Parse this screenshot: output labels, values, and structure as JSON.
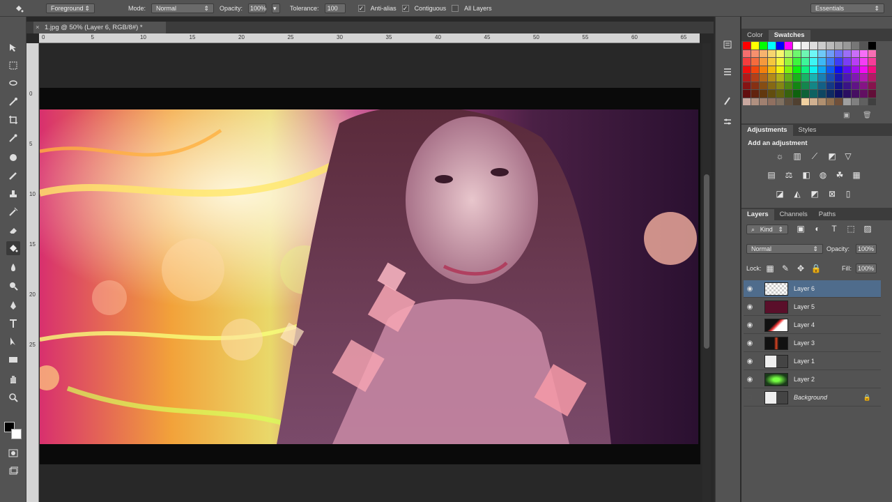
{
  "options_bar": {
    "brush_preset": "Foreground",
    "mode_label": "Mode:",
    "mode_value": "Normal",
    "opacity_label": "Opacity:",
    "opacity_value": "100%",
    "tolerance_label": "Tolerance:",
    "tolerance_value": "100",
    "anti_alias": "Anti-alias",
    "contiguous": "Contiguous",
    "all_layers": "All Layers",
    "workspace": "Essentials"
  },
  "document": {
    "tab_title": "1.jpg @ 50% (Layer 6, RGB/8#) *",
    "ruler_h": [
      "0",
      "5",
      "10",
      "15",
      "20",
      "25",
      "30",
      "35",
      "40",
      "45",
      "50",
      "55",
      "60",
      "65"
    ],
    "ruler_v": [
      "0",
      "5",
      "10",
      "15",
      "20",
      "25"
    ]
  },
  "panels": {
    "color_tab": "Color",
    "swatches_tab": "Swatches",
    "adjustments_tab": "Adjustments",
    "styles_tab": "Styles",
    "add_adjustment": "Add an adjustment",
    "layers_tab": "Layers",
    "channels_tab": "Channels",
    "paths_tab": "Paths",
    "kind_filter": "Kind",
    "blend_mode": "Normal",
    "opacity_label": "Opacity:",
    "opacity_value": "100%",
    "lock_label": "Lock:",
    "fill_label": "Fill:",
    "fill_value": "100%"
  },
  "layers": [
    {
      "name": "Layer 6",
      "selected": true
    },
    {
      "name": "Layer 5",
      "selected": false
    },
    {
      "name": "Layer 4",
      "selected": false
    },
    {
      "name": "Layer 3",
      "selected": false
    },
    {
      "name": "Layer 1",
      "selected": false
    },
    {
      "name": "Layer 2",
      "selected": false
    },
    {
      "name": "Background",
      "selected": false
    }
  ],
  "colors": {
    "selection": "#4f6c8c",
    "panel_bg": "#535353",
    "workspace_bg": "#282828"
  }
}
